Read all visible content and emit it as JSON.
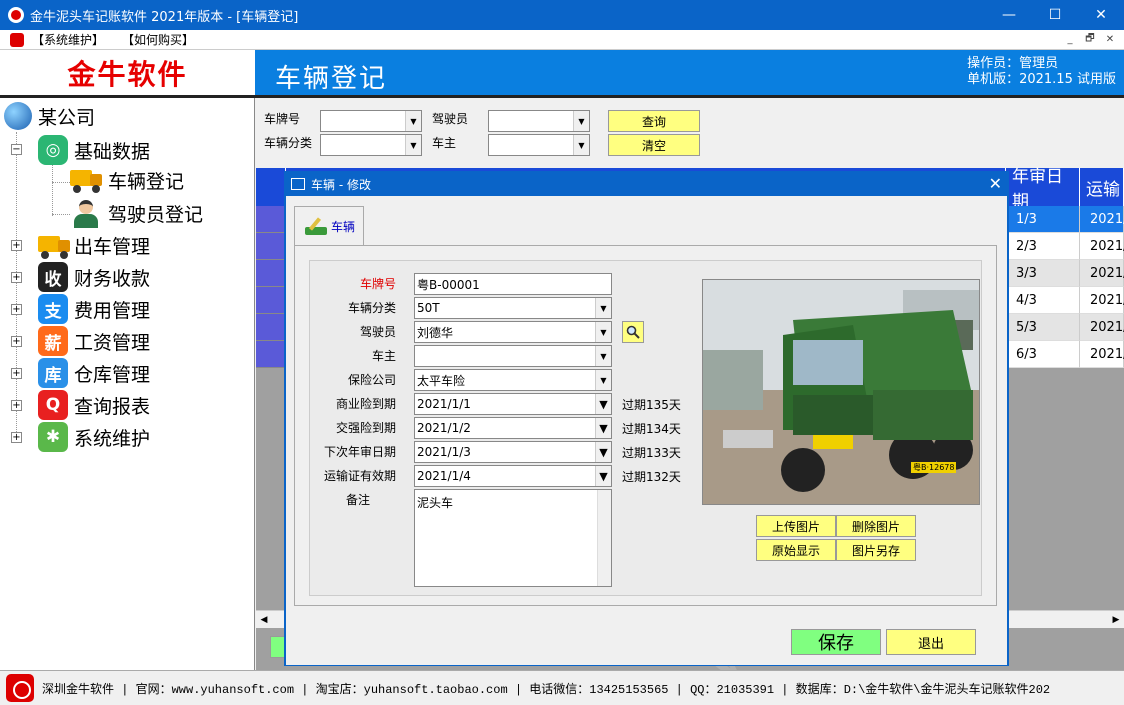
{
  "window": {
    "title": "金牛泥头车记账软件 2021年版本 - [车辆登记]",
    "minimize": "—",
    "maximize": "☐",
    "close": "✕"
  },
  "menubar": {
    "items": [
      "【系统维护】",
      "【如何购买】"
    ],
    "mdi": [
      "_",
      "🗗",
      "✕"
    ]
  },
  "logo": {
    "text": "金牛软件"
  },
  "header": {
    "title": "车辆登记",
    "operator": "操作员：管理员",
    "version": "单机版：2021.15 试用版"
  },
  "tree": {
    "root": "某公司",
    "nodes": [
      {
        "label": "基础数据",
        "icon": "grid-icon",
        "color": "#2bb673",
        "glyph": "◎",
        "expander": "−"
      },
      {
        "label": "车辆登记",
        "icon": "truck-icon",
        "child": true
      },
      {
        "label": "驾驶员登记",
        "icon": "driver-icon",
        "child": true
      },
      {
        "label": "出车管理",
        "icon": "truck-out-icon",
        "color": "#f5a623",
        "glyph": "▬",
        "expander": "+"
      },
      {
        "label": "财务收款",
        "icon": "receive-icon",
        "color": "#222222",
        "glyph": "收",
        "expander": "+"
      },
      {
        "label": "费用管理",
        "icon": "alipay-icon",
        "color": "#1a8cf0",
        "glyph": "支",
        "expander": "+"
      },
      {
        "label": "工资管理",
        "icon": "salary-icon",
        "color": "#ff6a1a",
        "glyph": "薪",
        "expander": "+"
      },
      {
        "label": "仓库管理",
        "icon": "warehouse-icon",
        "color": "#2a90e8",
        "glyph": "库",
        "expander": "+"
      },
      {
        "label": "查询报表",
        "icon": "search-report-icon",
        "color": "#e82020",
        "glyph": "Q",
        "expander": "+"
      },
      {
        "label": "系统维护",
        "icon": "gear-icon",
        "color": "#5ab84a",
        "glyph": "✱",
        "expander": "+"
      }
    ]
  },
  "search": {
    "plate_label": "车牌号",
    "category_label": "车辆分类",
    "driver_label": "驾驶员",
    "owner_label": "车主",
    "query_button": "查询",
    "clear_button": "清空"
  },
  "grid": {
    "headers": [
      "年审日期",
      "运输"
    ],
    "rows": [
      {
        "date": "1/3",
        "transport": "2021/"
      },
      {
        "date": "2/3",
        "transport": "2021/"
      },
      {
        "date": "3/3",
        "transport": "2021/"
      },
      {
        "date": "4/3",
        "transport": "2021/"
      },
      {
        "date": "5/3",
        "transport": "2021/"
      },
      {
        "date": "6/3",
        "transport": "2021/"
      }
    ],
    "scroll_left": "◀",
    "scroll_right": "▶"
  },
  "dialog": {
    "title": "车辆 - 修改",
    "close": "✕",
    "tab": "车辆",
    "labels": {
      "plate": "车牌号",
      "category": "车辆分类",
      "driver": "驾驶员",
      "owner": "车主",
      "insurer": "保险公司",
      "commercial": "商业险到期",
      "compulsory": "交强险到期",
      "inspection": "下次年审日期",
      "transport": "运输证有效期",
      "remark": "备注"
    },
    "values": {
      "plate": "粤B-00001",
      "category": "50T",
      "driver": "刘德华",
      "owner": "",
      "insurer": "太平车险",
      "commercial": "2021/1/1",
      "compulsory": "2021/1/2",
      "inspection": "2021/1/3",
      "transport": "2021/1/4",
      "remark": "泥头车"
    },
    "expired": {
      "commercial": "过期135天",
      "compulsory": "过期134天",
      "inspection": "过期133天",
      "transport": "过期132天"
    },
    "photo_buttons": {
      "upload": "上传图片",
      "delete": "删除图片",
      "original": "原始显示",
      "saveas": "图片另存"
    },
    "save": "保存",
    "exit": "退出",
    "photo_plate": "粤B·12678"
  },
  "status": {
    "text": "深圳金牛软件 | 官网：www.yuhansoft.com | 淘宝店：yuhansoft.taobao.com | 电话微信：13425153565 | QQ：21035391 | 数据库：D:\\金牛软件\\金牛泥头车记账软件202"
  },
  "colors": {
    "titlebar": "#0a64c8",
    "header": "#0a7fe0",
    "grid_header": "#1a4ad8",
    "selected_row": "#1a7ae8",
    "yellow_button": "#ffff80",
    "green_button": "#80ff80"
  }
}
